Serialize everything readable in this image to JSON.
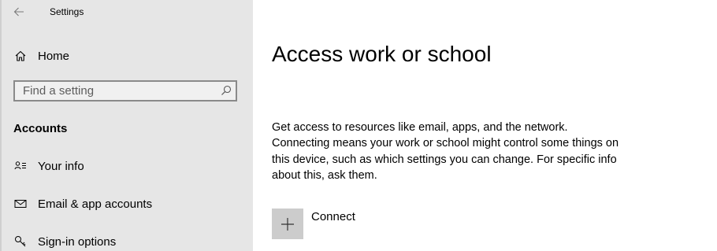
{
  "window": {
    "title": "Settings",
    "back_icon": "back-arrow-icon"
  },
  "sidebar": {
    "home": {
      "label": "Home",
      "icon": "home-icon"
    },
    "search": {
      "placeholder": "Find a setting",
      "value": "",
      "icon": "search-icon"
    },
    "section_heading": "Accounts",
    "items": [
      {
        "label": "Your info",
        "icon": "contact-card-icon"
      },
      {
        "label": "Email & app accounts",
        "icon": "mail-icon"
      },
      {
        "label": "Sign-in options",
        "icon": "key-icon"
      }
    ]
  },
  "main": {
    "title": "Access work or school",
    "description": "Get access to resources like email, apps, and the network. Connecting means your work or school might control some things on this device, such as which settings you can change. For specific info about this, ask them.",
    "connect": {
      "label": "Connect",
      "icon": "plus-icon"
    }
  },
  "colors": {
    "sidebar_bg": "#e6e6e6",
    "content_bg": "#ffffff",
    "tile_bg": "#cccccc"
  }
}
